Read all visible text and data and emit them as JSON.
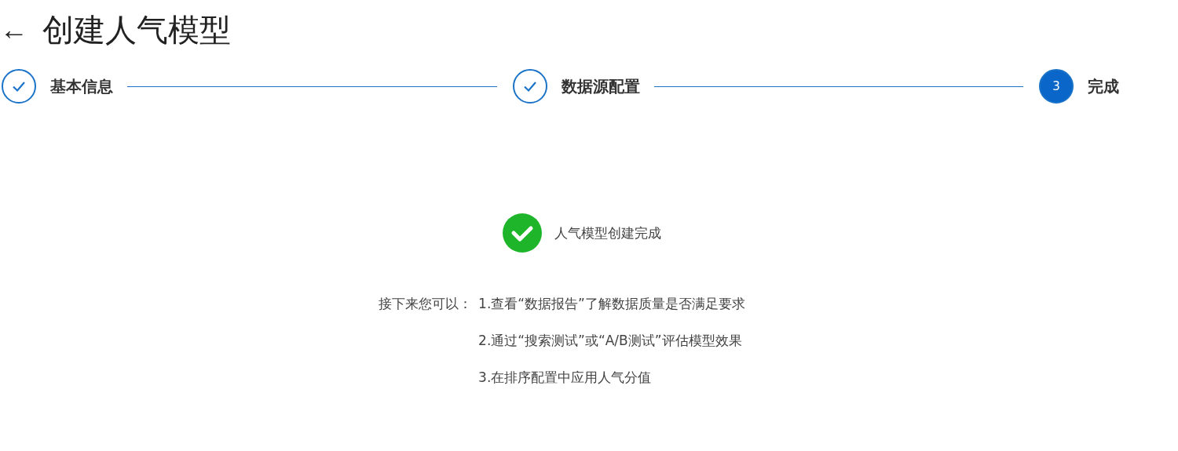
{
  "header": {
    "back": "←",
    "title": "创建人气模型"
  },
  "steps": [
    {
      "label": "基本信息",
      "done": true
    },
    {
      "label": "数据源配置",
      "done": true
    },
    {
      "label": "完成",
      "done": false,
      "number": "3"
    }
  ],
  "result": {
    "message": "人气模型创建完成",
    "next_label": "接下来您可以：",
    "next_items": [
      "1.查看“数据报告”了解数据质量是否满足要求",
      "2.通过“搜索测试”或“A/B测试”评估模型效果",
      "3.在排序配置中应用人气分值"
    ]
  }
}
